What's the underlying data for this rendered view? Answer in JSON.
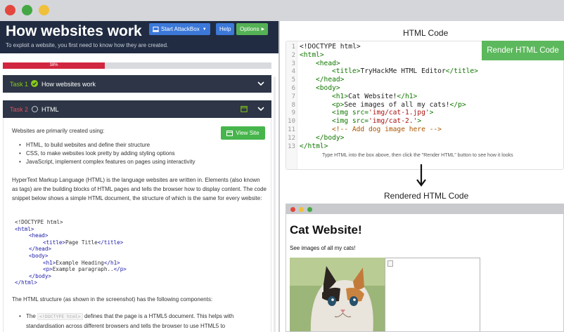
{
  "left": {
    "title": "How websites work",
    "subtitle": "To exploit a website, you first need to know how they are created.",
    "buttons": {
      "attackbox": "Start AttackBox",
      "help": "Help",
      "options": "Options"
    },
    "progress": {
      "percent_label": "38%",
      "value": 38
    },
    "task1": {
      "num": "Task 1",
      "label": "How websites work"
    },
    "task2": {
      "num": "Task 2",
      "label": "HTML"
    },
    "body": {
      "intro": "Websites are primarily created using:",
      "view_site": "View Site",
      "bullets": [
        "HTML, to build websites and define their structure",
        "CSS, to make websites look pretty by adding styling options",
        "JavaScript, implement complex features on pages using interactivity"
      ],
      "para": "HyperText Markup Language (HTML) is the language websites are written in. Elements (also known as tags) are the building blocks of HTML pages and tells the browser how to display content. The code snippet below shows a simple HTML document, the structure of which is the same for every website:",
      "code": [
        {
          "text": "<!DOCTYPE html>",
          "kind": "doc",
          "indent": 0
        },
        {
          "text": "<html>",
          "kind": "tag",
          "indent": 0
        },
        {
          "text": "<head>",
          "kind": "tag",
          "indent": 1
        },
        {
          "pre": "<title>",
          "mid": "Page Title",
          "post": "</title>",
          "kind": "mixed",
          "indent": 2
        },
        {
          "text": "</head>",
          "kind": "tag",
          "indent": 1
        },
        {
          "text": "<body>",
          "kind": "tag",
          "indent": 1
        },
        {
          "pre": "<h1>",
          "mid": "Example Heading",
          "post": "</h1>",
          "kind": "mixed",
          "indent": 2
        },
        {
          "pre": "<p>",
          "mid": "Example paragraph..",
          "post": "</p>",
          "kind": "mixed",
          "indent": 2
        },
        {
          "text": "</body>",
          "kind": "tag",
          "indent": 1
        },
        {
          "text": "</html>",
          "kind": "tag",
          "indent": 0
        }
      ],
      "para2": "The HTML structure (as shown in the screenshot) has the following components:",
      "bullet2": {
        "pre": "The ",
        "code": "<!DOCTYPE html>",
        "post": " defines that the page is a HTML5 document. This helps with standardisation across different browsers and tells the browser to use HTML5 to"
      }
    }
  },
  "right": {
    "html_code_title": "HTML Code",
    "render_button": "Render HTML Code",
    "hint": "Type HTML into the box above, then click the \"Render HTML\" button to see how it looks",
    "rendered_title": "Rendered HTML Code",
    "editor_lines": [
      {
        "n": "1",
        "indent": 0,
        "parts": [
          {
            "c": "d",
            "t": "<!DOCTYPE html>"
          }
        ]
      },
      {
        "n": "2",
        "indent": 0,
        "parts": [
          {
            "c": "t",
            "t": "<html>"
          }
        ]
      },
      {
        "n": "3",
        "indent": 1,
        "parts": [
          {
            "c": "t",
            "t": "<head>"
          }
        ]
      },
      {
        "n": "4",
        "indent": 2,
        "parts": [
          {
            "c": "t",
            "t": "<title>"
          },
          {
            "c": "d",
            "t": "TryHackMe HTML Editor"
          },
          {
            "c": "t",
            "t": "</title>"
          }
        ]
      },
      {
        "n": "5",
        "indent": 1,
        "parts": [
          {
            "c": "t",
            "t": "</head>"
          }
        ]
      },
      {
        "n": "6",
        "indent": 1,
        "parts": [
          {
            "c": "t",
            "t": "<body>"
          }
        ]
      },
      {
        "n": "7",
        "indent": 2,
        "parts": [
          {
            "c": "t",
            "t": "<h1>"
          },
          {
            "c": "d",
            "t": "Cat Website!"
          },
          {
            "c": "t",
            "t": "</h1>"
          }
        ]
      },
      {
        "n": "8",
        "indent": 2,
        "parts": [
          {
            "c": "t",
            "t": "<p>"
          },
          {
            "c": "d",
            "t": "See images of all my cats!"
          },
          {
            "c": "t",
            "t": "</p>"
          }
        ]
      },
      {
        "n": "9",
        "indent": 2,
        "parts": [
          {
            "c": "t",
            "t": "<img "
          },
          {
            "c": "t",
            "t": "src="
          },
          {
            "c": "s",
            "t": "'img/cat-1.jpg'"
          },
          {
            "c": "t",
            "t": ">"
          }
        ]
      },
      {
        "n": "10",
        "indent": 2,
        "parts": [
          {
            "c": "t",
            "t": "<img "
          },
          {
            "c": "t",
            "t": "src="
          },
          {
            "c": "s",
            "t": "'img/cat-2.'"
          },
          {
            "c": "t",
            "t": ">"
          }
        ]
      },
      {
        "n": "11",
        "indent": 2,
        "parts": [
          {
            "c": "c",
            "t": "<!-- Add dog image here -->"
          }
        ]
      },
      {
        "n": "12",
        "indent": 1,
        "parts": [
          {
            "c": "t",
            "t": "</body>"
          }
        ]
      },
      {
        "n": "13",
        "indent": 0,
        "parts": [
          {
            "c": "t",
            "t": "</html>"
          }
        ]
      }
    ],
    "preview": {
      "h1": "Cat Website!",
      "p": "See images of all my cats!"
    }
  },
  "colors": {
    "header_bg": "#212c42",
    "progress_fill": "#d1263f",
    "task_bg": "#2d3546",
    "green_button": "#5cb85c",
    "blue_button": "#3b78d8"
  }
}
